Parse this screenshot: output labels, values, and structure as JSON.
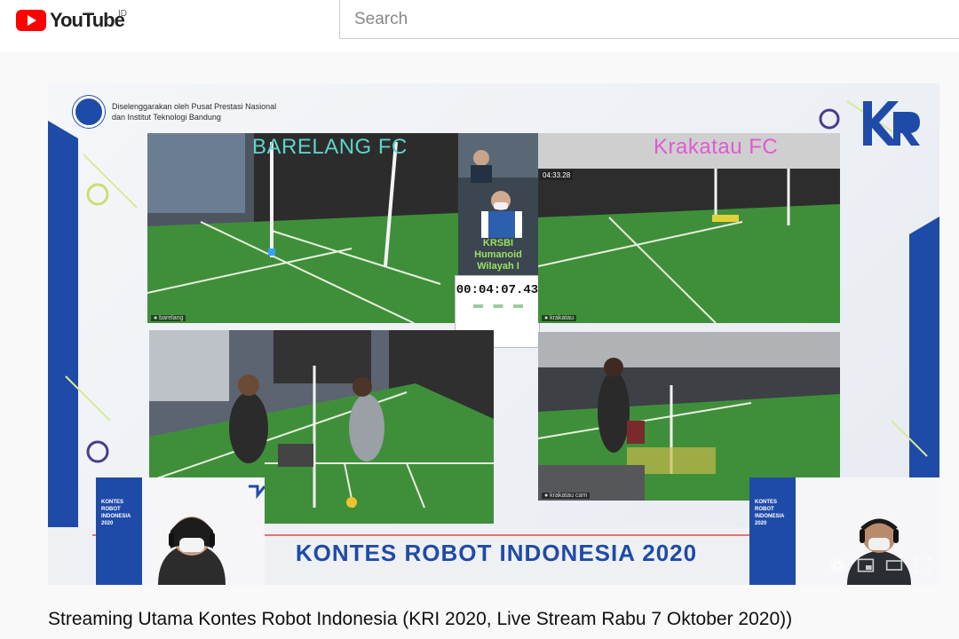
{
  "header": {
    "logo_text": "YouTube",
    "region": "ID",
    "search_placeholder": "Search"
  },
  "video": {
    "organizer_line1": "Diselenggarakan oleh Pusat Prestasi Nasional",
    "organizer_line2": "dan Institut Teknologi Bandung",
    "team_left": "BARELANG FC",
    "team_right": "Krakatau FC",
    "krsbi_line1": "KRSBI",
    "krsbi_line2": "Humanoid",
    "krsbi_line3": "Wilayah I",
    "timer": "00:04:07.43",
    "small_score": "04:33.28",
    "banner": "KONTES ROBOT INDONESIA 2020",
    "mini_brand_left": "KONTES ROBOT INDONESIA 2020",
    "mini_brand_right": "KONTES ROBOT INDONESIA 2020"
  },
  "title": "Streaming Utama Kontes Robot Indonesia (KRI 2020, Live Stream Rabu 7 Oktober 2020))",
  "colors": {
    "brand_red": "#ff0000",
    "kri_blue": "#1f4ba8",
    "team_left_label": "#5fd3c9",
    "team_right_label": "#e05ad0",
    "field_green": "#3f8f3a"
  },
  "icons": {
    "logo": "youtube-play-icon",
    "settings": "gear-icon",
    "miniplayer": "miniplayer-icon",
    "theater": "theater-mode-icon",
    "fullscreen": "fullscreen-icon"
  }
}
